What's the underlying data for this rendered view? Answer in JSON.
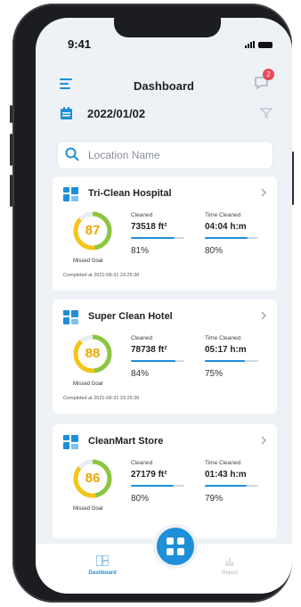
{
  "status": {
    "time": "9:41"
  },
  "header": {
    "title": "Dashboard",
    "notification_count": "2"
  },
  "date": "2022/01/02",
  "search": {
    "placeholder": "Location Name"
  },
  "labels": {
    "cleaned": "Cleaned",
    "time_cleaned": "Time Cleaned",
    "missed_goal": "Missed Goal"
  },
  "locations": [
    {
      "name": "Tri-Clean Hospital",
      "score": "87",
      "score_fraction": 0.87,
      "cleaned": "73518 ft²",
      "cleaned_pct": "81%",
      "cleaned_fraction": 0.81,
      "time": "04:04 h:m",
      "time_pct": "80%",
      "time_fraction": 0.8,
      "completed": "Completed at 2021-08-31 23:25:30"
    },
    {
      "name": "Super Clean Hotel",
      "score": "88",
      "score_fraction": 0.88,
      "cleaned": "78738 ft²",
      "cleaned_pct": "84%",
      "cleaned_fraction": 0.84,
      "time": "05:17 h:m",
      "time_pct": "75%",
      "time_fraction": 0.75,
      "completed": "Completed at 2021-08-31 23:25:30"
    },
    {
      "name": "CleanMart Store",
      "score": "86",
      "score_fraction": 0.86,
      "cleaned": "27179 ft²",
      "cleaned_pct": "80%",
      "cleaned_fraction": 0.8,
      "time": "01:43 h:m",
      "time_pct": "79%",
      "time_fraction": 0.79,
      "completed": ""
    }
  ],
  "tabs": {
    "dashboard": "Dashboard",
    "report": "Report"
  },
  "colors": {
    "accent": "#1e8fd8",
    "score": "#f0a500",
    "ring_green": "#8cc63f",
    "badge": "#e94a55"
  }
}
